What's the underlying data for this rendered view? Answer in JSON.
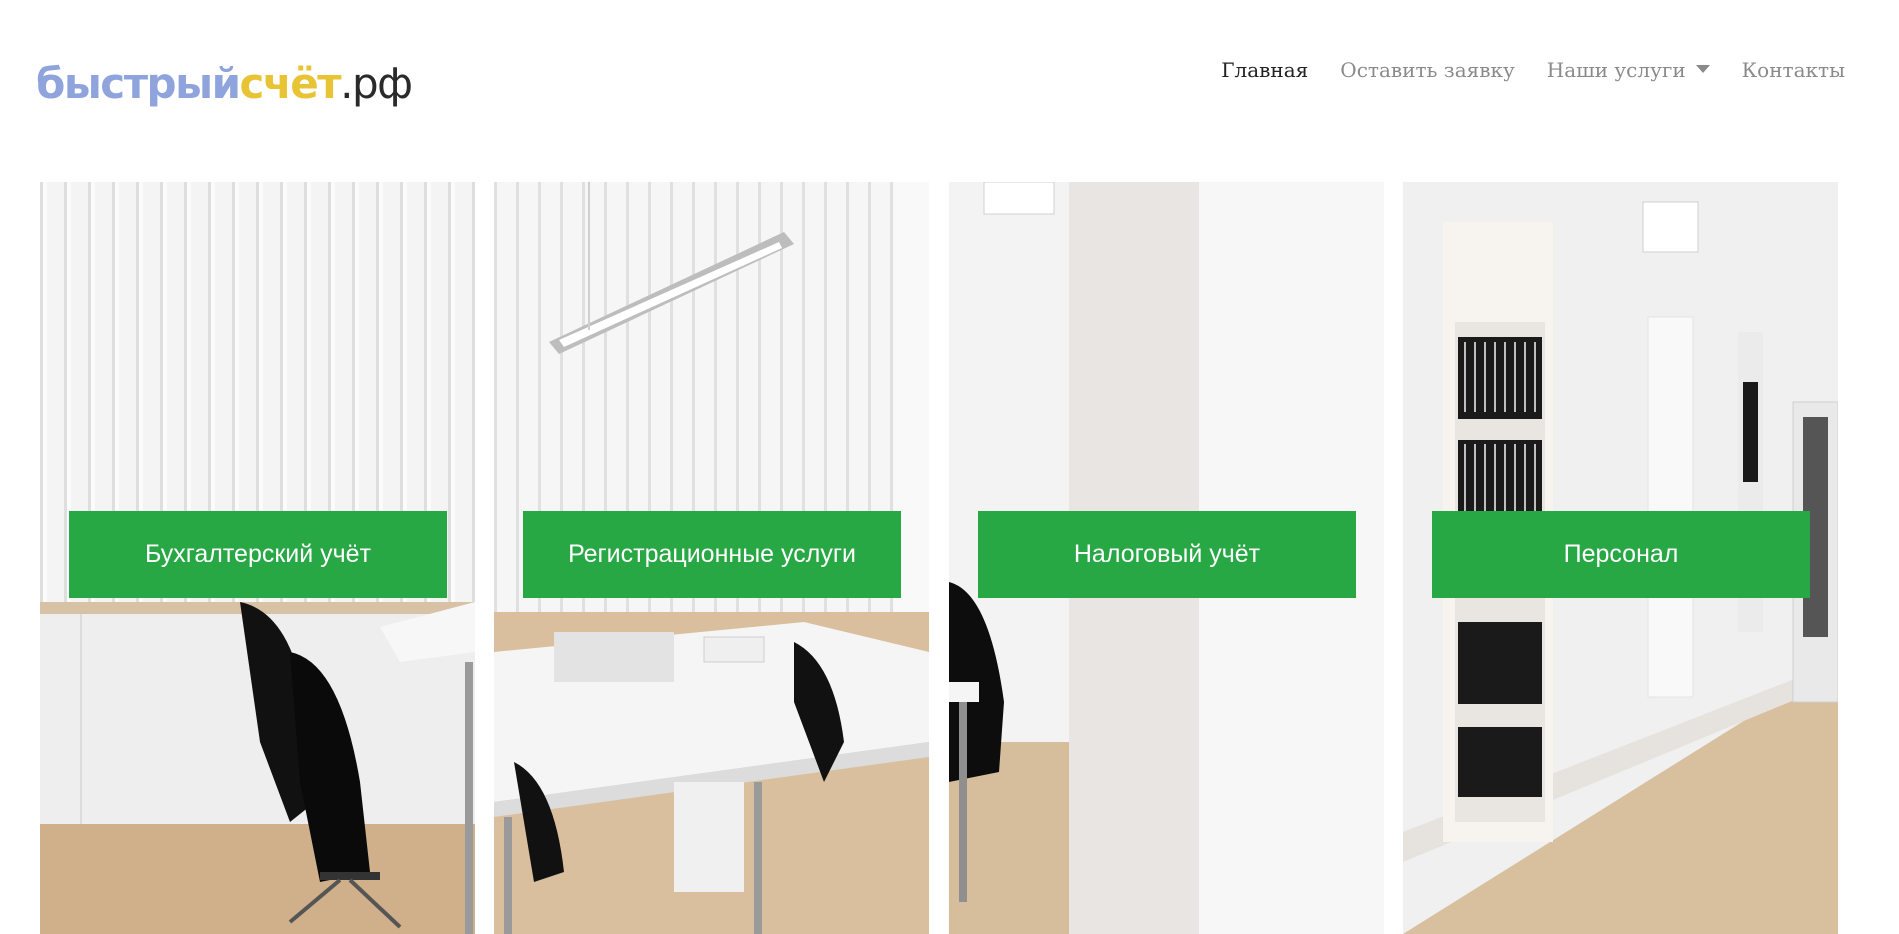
{
  "logo": {
    "part1": "быстрый",
    "part2": "счёт",
    "part3": ".рф",
    "color1": "#8fa4dc",
    "color2": "#e8c435"
  },
  "nav": {
    "items": [
      {
        "label": "Главная",
        "active": true
      },
      {
        "label": "Оставить заявку"
      },
      {
        "label": "Наши услуги",
        "dropdown": true
      },
      {
        "label": "Контакты"
      }
    ]
  },
  "services": [
    {
      "label": "Бухгалтерский учёт"
    },
    {
      "label": "Регистрационные услуги"
    },
    {
      "label": "Налоговый учёт"
    },
    {
      "label": "Персонал"
    }
  ],
  "colors": {
    "accent": "#28a745"
  }
}
